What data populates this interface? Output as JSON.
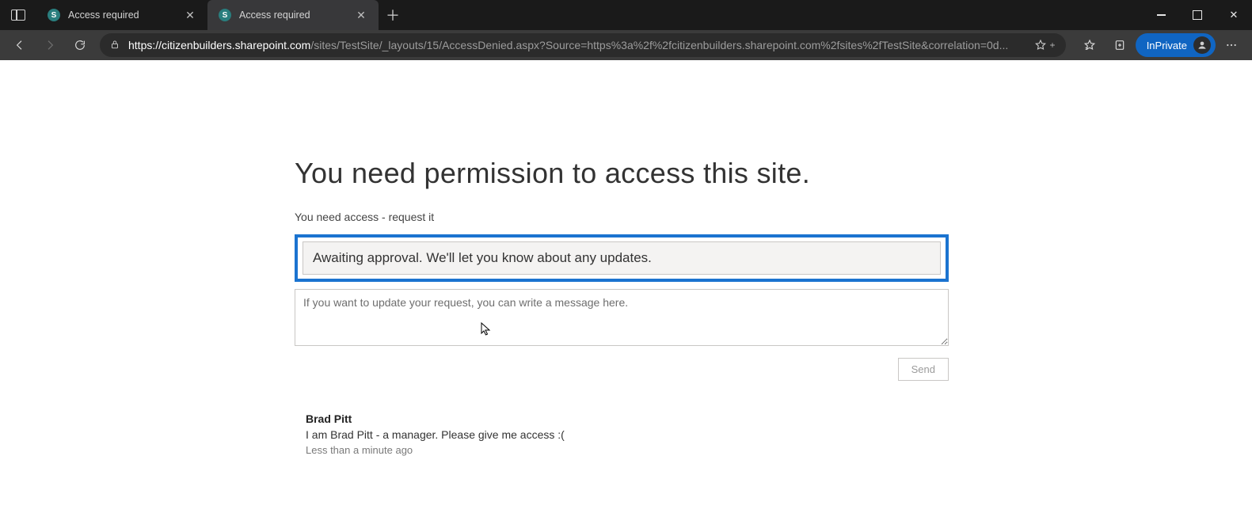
{
  "browser": {
    "tabs": [
      {
        "title": "Access required",
        "active": false
      },
      {
        "title": "Access required",
        "active": true
      }
    ],
    "url_host": "https://citizenbuilders.sharepoint.com",
    "url_rest": "/sites/TestSite/_layouts/15/AccessDenied.aspx?Source=https%3a%2f%2fcitizenbuilders.sharepoint.com%2fsites%2fTestSite&correlation=0d...",
    "inprivate_label": "InPrivate"
  },
  "page": {
    "heading": "You need permission to access this site.",
    "subline": "You need access - request it",
    "status_message": "Awaiting approval. We'll let you know about any updates.",
    "update_placeholder": "If you want to update your request, you can write a message here.",
    "send_label": "Send",
    "request": {
      "author": "Brad Pitt",
      "message": "I am Brad Pitt - a manager. Please give me access :(",
      "timestamp": "Less than a minute ago"
    }
  }
}
